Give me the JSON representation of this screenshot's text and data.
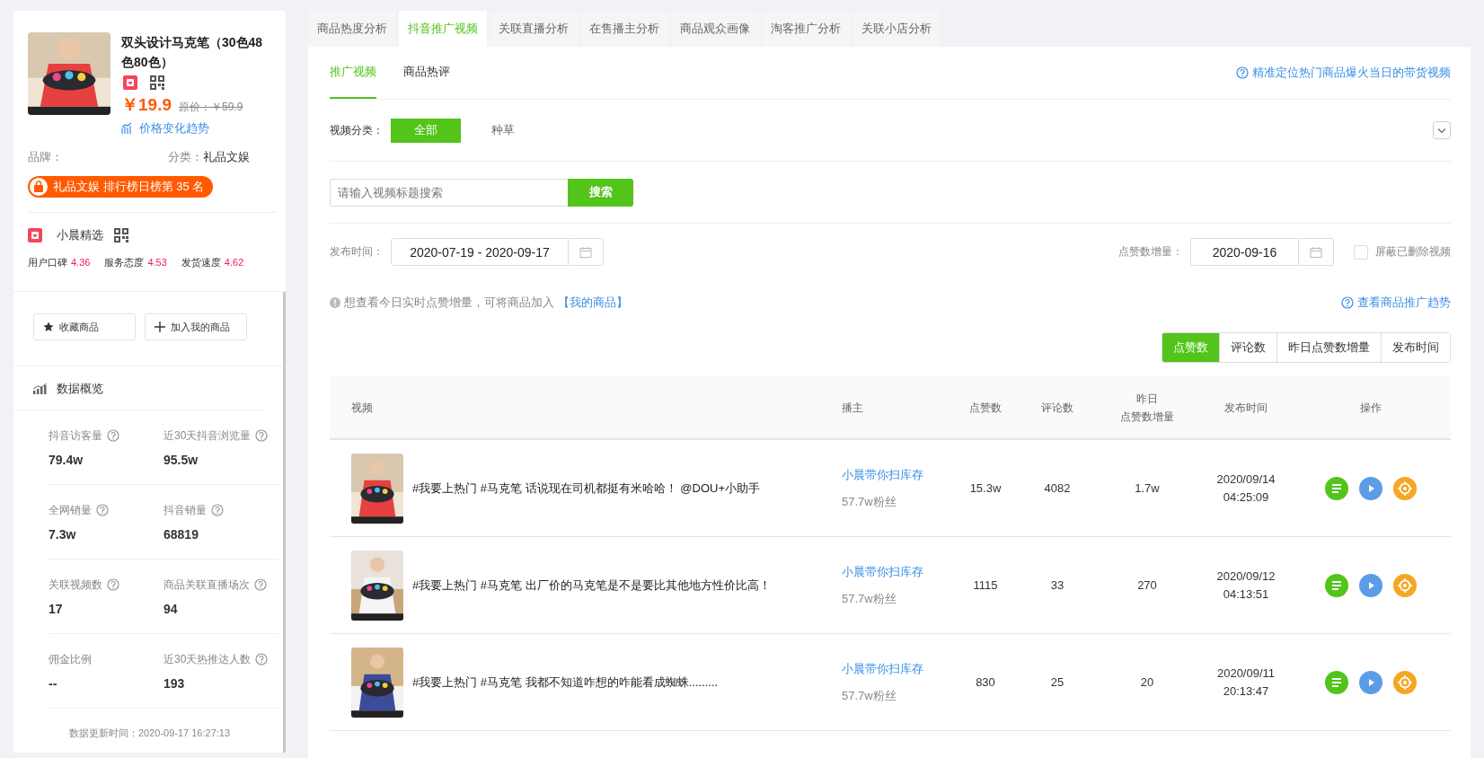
{
  "product": {
    "title": "双头设计马克笔（30色48色80色）",
    "price": "￥19.9",
    "original_price": "原价：￥59.9",
    "price_trend": "价格变化趋势",
    "brand_label": "品牌：",
    "category_label": "分类：",
    "category": "礼品文娱",
    "rank_badge": "礼品文娱 排行榜日榜第 35 名"
  },
  "shop": {
    "name": "小晨精选",
    "ratings": [
      {
        "label": "用户口碑",
        "value": "4.36"
      },
      {
        "label": "服务态度",
        "value": "4.53"
      },
      {
        "label": "发货速度",
        "value": "4.62"
      }
    ]
  },
  "actions": [
    {
      "kind": "star",
      "label": "收藏商品"
    },
    {
      "kind": "plus",
      "label": "加入我的商品"
    }
  ],
  "overview": {
    "title": "数据概览",
    "metrics": [
      {
        "label": "抖音访客量",
        "help": true,
        "value": "79.4w"
      },
      {
        "label": "近30天抖音浏览量",
        "help": true,
        "value": "95.5w"
      },
      {
        "label": "全网销量",
        "help": true,
        "value": "7.3w"
      },
      {
        "label": "抖音销量",
        "help": true,
        "value": "68819"
      },
      {
        "label": "关联视频数",
        "help": true,
        "value": "17"
      },
      {
        "label": "商品关联直播场次",
        "help": true,
        "value": "94"
      },
      {
        "label": "佣金比例",
        "help": false,
        "value": "--"
      },
      {
        "label": "近30天热推达人数",
        "help": true,
        "value": "193"
      }
    ],
    "updated": "数据更新时间：2020-09-17 16:27:13"
  },
  "tabs": [
    {
      "label": "商品热度分析",
      "selected": false
    },
    {
      "label": "抖音推广视频",
      "selected": true
    },
    {
      "label": "关联直播分析",
      "selected": false
    },
    {
      "label": "在售播主分析",
      "selected": false
    },
    {
      "label": "商品观众画像",
      "selected": false
    },
    {
      "label": "淘客推广分析",
      "selected": false
    },
    {
      "label": "关联小店分析",
      "selected": false
    }
  ],
  "subtabs": [
    {
      "label": "推广视频",
      "selected": true
    },
    {
      "label": "商品热评",
      "selected": false
    }
  ],
  "help_link": "精准定位热门商品爆火当日的带货视频",
  "category_filter": {
    "label": "视频分类：",
    "options": [
      {
        "label": "全部",
        "selected": true
      },
      {
        "label": "种草",
        "selected": false
      }
    ]
  },
  "search": {
    "placeholder": "请输入视频标题搜索",
    "button": "搜索"
  },
  "publish_date": {
    "label": "发布时间：",
    "value": "2020-07-19 - 2020-09-17"
  },
  "likes_date": {
    "label": "点赞数增量：",
    "value": "2020-09-16"
  },
  "hide_deleted": {
    "label": "屏蔽已删除视频",
    "checked": false
  },
  "notice": {
    "text": "想查看今日实时点赞增量，可将商品加入",
    "link": "【我的商品】"
  },
  "trend_link": "查看商品推广趋势",
  "sort_buttons": [
    {
      "label": "点赞数",
      "selected": true
    },
    {
      "label": "评论数",
      "selected": false
    },
    {
      "label": "昨日点赞数增量",
      "selected": false
    },
    {
      "label": "发布时间",
      "selected": false
    }
  ],
  "table": {
    "columns": [
      [
        "视频"
      ],
      [
        "播主"
      ],
      [
        "点赞数"
      ],
      [
        "评论数"
      ],
      [
        "昨日",
        "点赞数增量"
      ],
      [
        "发布时间"
      ],
      [
        "操作"
      ]
    ],
    "rows": [
      {
        "title": "#我要上热门 #马克笔 话说现在司机都挺有米哈哈！ @DOU+小助手",
        "author": "小晨带你扫库存",
        "fans": "57.7w粉丝",
        "likes": "15.3w",
        "comments": "4082",
        "yesterday": "1.7w",
        "date": "2020/09/14",
        "time": "04:25:09"
      },
      {
        "title": "#我要上热门 #马克笔 出厂价的马克笔是不是要比其他地方性价比高！",
        "author": "小晨带你扫库存",
        "fans": "57.7w粉丝",
        "likes": "1115",
        "comments": "33",
        "yesterday": "270",
        "date": "2020/09/12",
        "time": "04:13:51"
      },
      {
        "title": "#我要上热门 #马克笔 我都不知道咋想的咋能看成蜘蛛.........",
        "author": "小晨带你扫库存",
        "fans": "57.7w粉丝",
        "likes": "830",
        "comments": "25",
        "yesterday": "20",
        "date": "2020/09/11",
        "time": "20:13:47"
      }
    ]
  }
}
